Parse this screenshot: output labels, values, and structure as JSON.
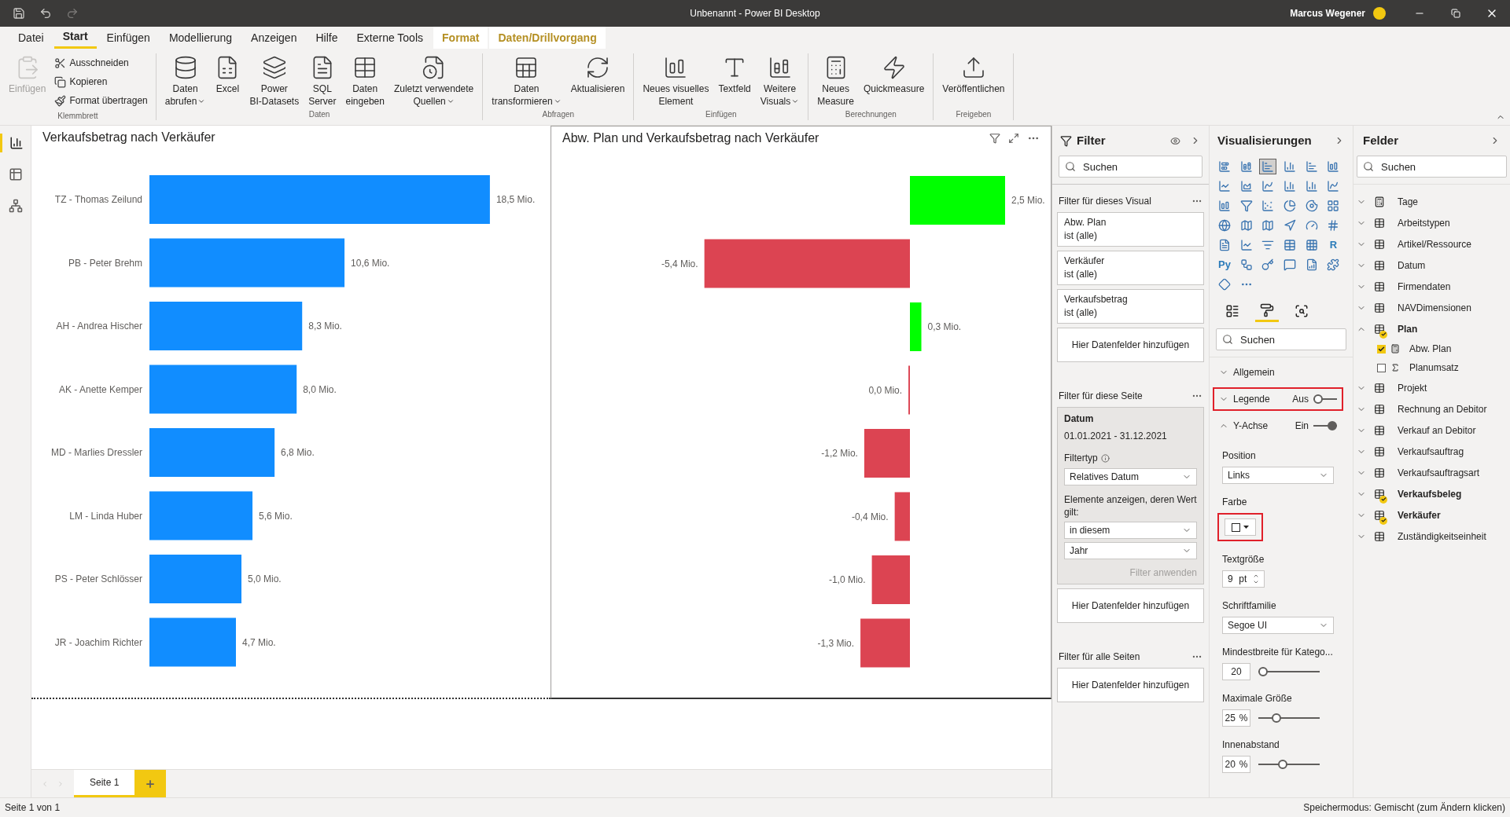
{
  "window": {
    "title": "Unbenannt - Power BI Desktop",
    "user": "Marcus Wegener"
  },
  "menu_tabs": [
    {
      "label": "Datei",
      "selected": false,
      "kind": "normal"
    },
    {
      "label": "Start",
      "selected": true,
      "kind": "normal"
    },
    {
      "label": "Einfügen",
      "selected": false,
      "kind": "normal"
    },
    {
      "label": "Modellierung",
      "selected": false,
      "kind": "normal"
    },
    {
      "label": "Anzeigen",
      "selected": false,
      "kind": "normal"
    },
    {
      "label": "Hilfe",
      "selected": false,
      "kind": "normal"
    },
    {
      "label": "Externe Tools",
      "selected": false,
      "kind": "normal"
    },
    {
      "label": "Format",
      "selected": false,
      "kind": "contextual"
    },
    {
      "label": "Daten/Drillvorgang",
      "selected": false,
      "kind": "contextual"
    }
  ],
  "ribbon_groups": [
    {
      "label": "Klemmbrett",
      "buttons": [
        {
          "kind": "large",
          "lines": [
            "Einfügen"
          ],
          "dropdown": false,
          "disabled": true
        },
        {
          "kind": "small",
          "lines": [
            "Ausschneiden"
          ],
          "dropdown": false,
          "disabled": false
        },
        {
          "kind": "small",
          "lines": [
            "Kopieren"
          ],
          "dropdown": false,
          "disabled": false
        },
        {
          "kind": "small",
          "lines": [
            "Format übertragen"
          ],
          "dropdown": false,
          "disabled": false
        }
      ]
    },
    {
      "label": "Daten",
      "buttons": [
        {
          "kind": "large",
          "lines": [
            "Daten",
            "abrufen"
          ],
          "dropdown": true,
          "disabled": false
        },
        {
          "kind": "large",
          "lines": [
            "Excel"
          ],
          "dropdown": false,
          "disabled": false
        },
        {
          "kind": "large",
          "lines": [
            "Power",
            "BI-Datasets"
          ],
          "dropdown": false,
          "disabled": false
        },
        {
          "kind": "large",
          "lines": [
            "SQL",
            "Server"
          ],
          "dropdown": false,
          "disabled": false
        },
        {
          "kind": "large",
          "lines": [
            "Daten",
            "eingeben"
          ],
          "dropdown": false,
          "disabled": false
        },
        {
          "kind": "large",
          "lines": [
            "Zuletzt verwendete",
            "Quellen"
          ],
          "dropdown": true,
          "disabled": false
        }
      ]
    },
    {
      "label": "Abfragen",
      "buttons": [
        {
          "kind": "large",
          "lines": [
            "Daten",
            "transformieren"
          ],
          "dropdown": true,
          "disabled": false
        },
        {
          "kind": "large",
          "lines": [
            "Aktualisieren"
          ],
          "dropdown": false,
          "disabled": false
        }
      ]
    },
    {
      "label": "Einfügen",
      "buttons": [
        {
          "kind": "large",
          "lines": [
            "Neues visuelles",
            "Element"
          ],
          "dropdown": false,
          "disabled": false
        },
        {
          "kind": "large",
          "lines": [
            "Textfeld"
          ],
          "dropdown": false,
          "disabled": false
        },
        {
          "kind": "large",
          "lines": [
            "Weitere",
            "Visuals"
          ],
          "dropdown": true,
          "disabled": false
        }
      ]
    },
    {
      "label": "Berechnungen",
      "buttons": [
        {
          "kind": "large",
          "lines": [
            "Neues",
            "Measure"
          ],
          "dropdown": false,
          "disabled": false
        },
        {
          "kind": "large",
          "lines": [
            "Quickmeasure"
          ],
          "dropdown": false,
          "disabled": false
        }
      ]
    },
    {
      "label": "Freigeben",
      "buttons": [
        {
          "kind": "large",
          "lines": [
            "Veröffentlichen"
          ],
          "dropdown": false,
          "disabled": false
        }
      ]
    }
  ],
  "nav": [
    {
      "selected": true
    },
    {
      "selected": false
    },
    {
      "selected": false
    }
  ],
  "visuals": [
    {
      "title": "Verkaufsbetrag nach Verkäufer",
      "selected": false,
      "chart_data": {
        "type": "bar",
        "orientation": "horizontal",
        "categories": [
          "TZ - Thomas Zeilund",
          "PB - Peter Brehm",
          "AH - Andrea Hischer",
          "AK - Anette Kemper",
          "MD - Marlies Dressler",
          "LM - Linda Huber",
          "PS - Peter Schlösser",
          "JR - Joachim Richter"
        ],
        "series": [
          {
            "color": "#118dff",
            "values": [
              18.5,
              10.6,
              8.3,
              8.0,
              6.8,
              5.6,
              5.0,
              4.7
            ],
            "value_labels": [
              "18,5 Mio.",
              "10,6 Mio.",
              "8,3 Mio.",
              "8,0 Mio.",
              "6,8 Mio.",
              "5,6 Mio.",
              "5,0 Mio.",
              "4,7 Mio."
            ]
          }
        ]
      }
    },
    {
      "title": "Abw. Plan und Verkaufsbetrag nach Verkäufer",
      "selected": true,
      "chart_data": {
        "type": "bar",
        "orientation": "horizontal",
        "stacked": true,
        "series": [
          {
            "color": "#00ff00",
            "values": [
              2.5,
              null,
              0.3,
              null,
              null,
              null,
              null,
              null
            ],
            "value_labels": [
              "2,5 Mio.",
              null,
              "0,3 Mio.",
              null,
              null,
              null,
              null,
              null
            ]
          },
          {
            "color": "#dc4452",
            "values": [
              null,
              -5.4,
              null,
              -0.04,
              -1.2,
              -0.4,
              -1.0,
              -1.3
            ],
            "value_labels": [
              null,
              "-5,4 Mio.",
              null,
              "0,0 Mio.",
              "-1,2 Mio.",
              "-0,4 Mio.",
              "-1,0 Mio.",
              "-1,3 Mio."
            ]
          }
        ]
      }
    }
  ],
  "pages": [
    {
      "label": "Seite 1",
      "selected": true
    }
  ],
  "filter_pane": {
    "title": "Filter",
    "search_placeholder": "Suchen",
    "sections": [
      {
        "title": "Filter für dieses Visual",
        "cards": [
          {
            "kind": "summary",
            "field": "Abw. Plan",
            "state": "ist (alle)"
          },
          {
            "kind": "summary",
            "field": "Verkäufer",
            "state": "ist (alle)"
          },
          {
            "kind": "summary",
            "field": "Verkaufsbetrag",
            "state": "ist (alle)"
          }
        ],
        "add_label": "Hier Datenfelder hinzufügen"
      },
      {
        "title": "Filter für diese Seite",
        "cards": [
          {
            "kind": "expanded",
            "field": "Datum",
            "state": "01.01.2021 - 31.12.2021",
            "filter_type_label": "Filtertyp",
            "filter_type": "Relatives Datum",
            "condition_label": "Elemente anzeigen, deren Wert gilt:",
            "condition": "in diesem",
            "unit": "Jahr",
            "apply_label": "Filter anwenden",
            "apply_disabled": true
          }
        ],
        "add_label": "Hier Datenfelder hinzufügen"
      },
      {
        "title": "Filter für alle Seiten",
        "add_label": "Hier Datenfelder hinzufügen"
      }
    ]
  },
  "visualizations": {
    "title": "Visualisierungen",
    "gallery": [
      {
        "selected": false
      },
      {
        "selected": false
      },
      {
        "selected": true
      },
      {
        "selected": false
      },
      {
        "selected": false
      },
      {
        "selected": false
      },
      {
        "selected": false
      },
      {
        "selected": false
      },
      {
        "selected": false
      },
      {
        "selected": false
      },
      {
        "selected": false
      },
      {
        "selected": false
      },
      {
        "selected": false
      },
      {
        "selected": false
      },
      {
        "selected": false
      },
      {
        "selected": false
      },
      {
        "selected": false
      },
      {
        "selected": false
      },
      {
        "selected": false
      },
      {
        "selected": false
      },
      {
        "selected": false
      },
      {
        "selected": false
      },
      {
        "selected": false
      },
      {
        "selected": false
      },
      {
        "selected": false
      },
      {
        "selected": false
      },
      {
        "selected": false
      },
      {
        "selected": false
      },
      {
        "selected": false
      },
      {
        "selected": false,
        "text": "R"
      },
      {
        "selected": false,
        "text": "Py"
      },
      {
        "selected": false
      },
      {
        "selected": false
      },
      {
        "selected": false
      },
      {
        "selected": false
      },
      {
        "selected": false
      },
      {
        "selected": false
      },
      {
        "selected": false
      }
    ],
    "format_tabs": [
      {
        "selected": false
      },
      {
        "selected": true
      },
      {
        "selected": false
      }
    ],
    "search_placeholder": "Suchen",
    "sections": [
      {
        "title": "Allgemein",
        "expanded": false,
        "highlighted": false
      },
      {
        "title": "Legende",
        "expanded": false,
        "highlighted": true,
        "toggle_label": "Aus",
        "on": false
      },
      {
        "title": "Y-Achse",
        "expanded": true,
        "highlighted": false,
        "toggle_label": "Ein",
        "on": true
      }
    ],
    "properties": [
      {
        "kind": "dropdown",
        "label": "Position",
        "value": "Links"
      },
      {
        "kind": "color",
        "label": "Farbe",
        "highlighted": true
      },
      {
        "kind": "spinner",
        "label": "Textgröße",
        "value": "9",
        "unit": "pt"
      },
      {
        "kind": "dropdown",
        "label": "Schriftfamilie",
        "value": "Segoe UI"
      },
      {
        "kind": "slider",
        "label": "Mindestbreite für Katego...",
        "value": "20",
        "level": 0
      },
      {
        "kind": "slider",
        "label": "Maximale Größe",
        "value": "25",
        "unit": "%",
        "level": 0.25
      },
      {
        "kind": "slider",
        "label": "Innenabstand",
        "value": "20",
        "unit": "%",
        "level": 0.38
      }
    ]
  },
  "fields": {
    "title": "Felder",
    "search_placeholder": "Suchen",
    "tables": [
      {
        "name": "Tage",
        "kind": "measures",
        "expanded": false,
        "used": false
      },
      {
        "name": "Arbeitstypen",
        "kind": "table",
        "expanded": false,
        "used": false
      },
      {
        "name": "Artikel/Ressource",
        "kind": "table",
        "expanded": false,
        "used": false
      },
      {
        "name": "Datum",
        "kind": "table",
        "expanded": false,
        "used": false
      },
      {
        "name": "Firmendaten",
        "kind": "table",
        "expanded": false,
        "used": false
      },
      {
        "name": "NAVDimensionen",
        "kind": "table",
        "expanded": false,
        "used": false
      },
      {
        "name": "Plan",
        "kind": "table",
        "expanded": true,
        "used": true,
        "children": [
          {
            "name": "Abw. Plan",
            "kind": "measure",
            "checked": true
          },
          {
            "name": "Planumsatz",
            "kind": "sum",
            "checked": false
          }
        ]
      },
      {
        "name": "Projekt",
        "kind": "table",
        "expanded": false,
        "used": false
      },
      {
        "name": "Rechnung an Debitor",
        "kind": "table",
        "expanded": false,
        "used": false
      },
      {
        "name": "Verkauf an Debitor",
        "kind": "table",
        "expanded": false,
        "used": false
      },
      {
        "name": "Verkaufsauftrag",
        "kind": "table",
        "expanded": false,
        "used": false
      },
      {
        "name": "Verkaufsauftragsart",
        "kind": "table",
        "expanded": false,
        "used": false
      },
      {
        "name": "Verkaufsbeleg",
        "kind": "table",
        "expanded": false,
        "used": true
      },
      {
        "name": "Verkäufer",
        "kind": "table",
        "expanded": false,
        "used": true
      },
      {
        "name": "Zuständigkeitseinheit",
        "kind": "table",
        "expanded": false,
        "used": false
      }
    ]
  },
  "status_bar": {
    "left": "Seite 1 von 1",
    "right": "Speichermodus: Gemischt (zum Ändern klicken)"
  }
}
